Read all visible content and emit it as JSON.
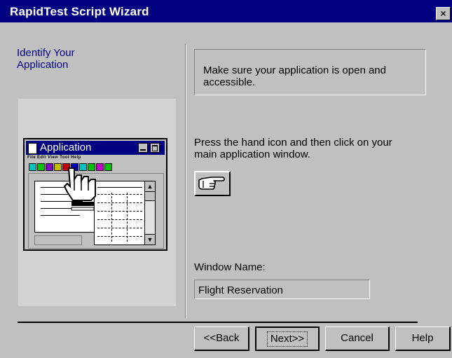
{
  "window": {
    "title": "RapidTest Script Wizard",
    "close_label": "×"
  },
  "step": {
    "title_line1": "Identify Your",
    "title_line2": "Application"
  },
  "illustration": {
    "app_title": "Application",
    "menu_text": "File Edit View Tool Help"
  },
  "info": {
    "line1": "Make sure your application is open and",
    "line2": "accessible."
  },
  "instruction": {
    "line1": "Press the hand icon and then click on your",
    "line2": "main application window."
  },
  "window_name": {
    "label": "Window Name:",
    "value": "Flight Reservation"
  },
  "buttons": {
    "back": "<<Back",
    "next": "Next>>",
    "cancel": "Cancel",
    "help": "Help"
  }
}
